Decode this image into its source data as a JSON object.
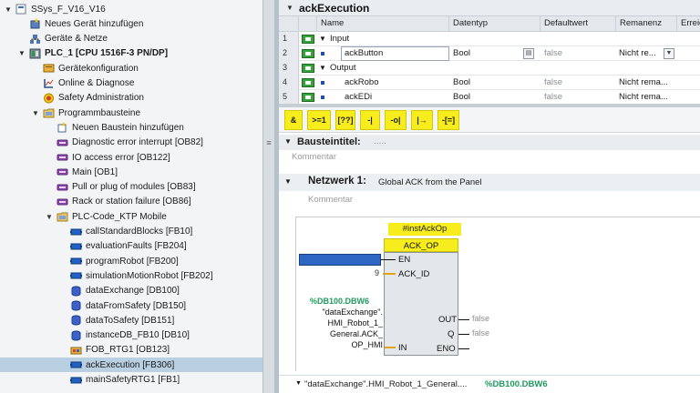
{
  "tree": {
    "items": [
      {
        "label": "SSys_F_V16_V16",
        "indent": 0,
        "toggle": "▼",
        "icon": "project-icon"
      },
      {
        "label": "Neues Gerät hinzufügen",
        "indent": 1,
        "toggle": "",
        "icon": "add-device-icon"
      },
      {
        "label": "Geräte & Netze",
        "indent": 1,
        "toggle": "",
        "icon": "network-icon"
      },
      {
        "label": "PLC_1 [CPU 1516F-3 PN/DP]",
        "indent": 1,
        "toggle": "▼",
        "icon": "plc-icon",
        "bold": true
      },
      {
        "label": "Gerätekonfiguration",
        "indent": 2,
        "toggle": "",
        "icon": "device-config-icon"
      },
      {
        "label": "Online & Diagnose",
        "indent": 2,
        "toggle": "",
        "icon": "diagnostics-icon"
      },
      {
        "label": "Safety Administration",
        "indent": 2,
        "toggle": "",
        "icon": "safety-icon"
      },
      {
        "label": "Programmbausteine",
        "indent": 2,
        "toggle": "▼",
        "icon": "folder-icon"
      },
      {
        "label": "Neuen Baustein hinzufügen",
        "indent": 3,
        "toggle": "",
        "icon": "add-block-icon"
      },
      {
        "label": "Diagnostic error interrupt [OB82]",
        "indent": 3,
        "toggle": "",
        "icon": "ob-icon"
      },
      {
        "label": "IO access error [OB122]",
        "indent": 3,
        "toggle": "",
        "icon": "ob-icon"
      },
      {
        "label": "Main [OB1]",
        "indent": 3,
        "toggle": "",
        "icon": "ob-icon"
      },
      {
        "label": "Pull or plug of modules [OB83]",
        "indent": 3,
        "toggle": "",
        "icon": "ob-icon"
      },
      {
        "label": "Rack or station failure [OB86]",
        "indent": 3,
        "toggle": "",
        "icon": "ob-icon"
      },
      {
        "label": "PLC-Code_KTP Mobile",
        "indent": 3,
        "toggle": "▼",
        "icon": "folder-icon"
      },
      {
        "label": "callStandardBlocks [FB10]",
        "indent": 4,
        "toggle": "",
        "icon": "fb-icon"
      },
      {
        "label": "evaluationFaults [FB204]",
        "indent": 4,
        "toggle": "",
        "icon": "fb-icon"
      },
      {
        "label": "programRobot [FB200]",
        "indent": 4,
        "toggle": "",
        "icon": "fb-icon"
      },
      {
        "label": "simulationMotionRobot [FB202]",
        "indent": 4,
        "toggle": "",
        "icon": "fb-icon"
      },
      {
        "label": "dataExchange [DB100]",
        "indent": 4,
        "toggle": "",
        "icon": "db-icon"
      },
      {
        "label": "dataFromSafety [DB150]",
        "indent": 4,
        "toggle": "",
        "icon": "db-icon"
      },
      {
        "label": "dataToSafety [DB151]",
        "indent": 4,
        "toggle": "",
        "icon": "db-icon"
      },
      {
        "label": "instanceDB_FB10 [DB10]",
        "indent": 4,
        "toggle": "",
        "icon": "db-icon"
      },
      {
        "label": "FOB_RTG1 [OB123]",
        "indent": 4,
        "toggle": "",
        "icon": "fob-icon"
      },
      {
        "label": "ackExecution [FB306]",
        "indent": 4,
        "toggle": "",
        "icon": "fb-icon",
        "selected": true
      },
      {
        "label": "mainSafetyRTG1 [FB1]",
        "indent": 4,
        "toggle": "",
        "icon": "fb-icon"
      }
    ]
  },
  "interface": {
    "title": "ackExecution",
    "columns": [
      "Name",
      "Datentyp",
      "Defaultwert",
      "Remanenz",
      "Erreic"
    ],
    "rows": [
      {
        "num": "1",
        "name": "Input",
        "section": true
      },
      {
        "num": "2",
        "name": "ackButton",
        "type": "Bool",
        "default": "false",
        "remanence": "Nicht re...",
        "editing": true
      },
      {
        "num": "3",
        "name": "Output",
        "section": true
      },
      {
        "num": "4",
        "name": "ackRobo",
        "type": "Bool",
        "default": "false",
        "remanence": "Nicht rema..."
      },
      {
        "num": "5",
        "name": "ackEDi",
        "type": "Bool",
        "default": "false",
        "remanence": "Nicht rema..."
      }
    ]
  },
  "toolbar": {
    "buttons": [
      "&",
      ">=1",
      "[??]",
      "-|",
      "-o|",
      "|→",
      "-[=]"
    ]
  },
  "block_title": {
    "label": "Bausteintitel:",
    "dots": ".....",
    "comment": "Kommentar"
  },
  "network": {
    "label": "Netzwerk 1:",
    "title": "Global ACK from the Panel",
    "comment": "Kommentar",
    "instance": "#instAckOp",
    "box_title": "ACK_OP",
    "pins_in": [
      "EN",
      "ACK_ID",
      "IN"
    ],
    "pins_out": [
      "OUT",
      "Q",
      "ENO"
    ],
    "ack_id_value": "9",
    "in_address": "%DB100.DBW6",
    "in_operand": [
      "\"dataExchange\".",
      "HMI_Robot_1_",
      "General.ACK_",
      "OP_HMI"
    ],
    "out_value": "false",
    "q_value": "false"
  },
  "bottom": {
    "text": "\"dataExchange\".HMI_Robot_1_General....",
    "address": "%DB100.DBW6"
  },
  "colors": {
    "instruction_yellow": "#f7ec1c",
    "selection": "#b9d0e3",
    "address_green": "#209a5e",
    "en_blue": "#2e66c4"
  }
}
